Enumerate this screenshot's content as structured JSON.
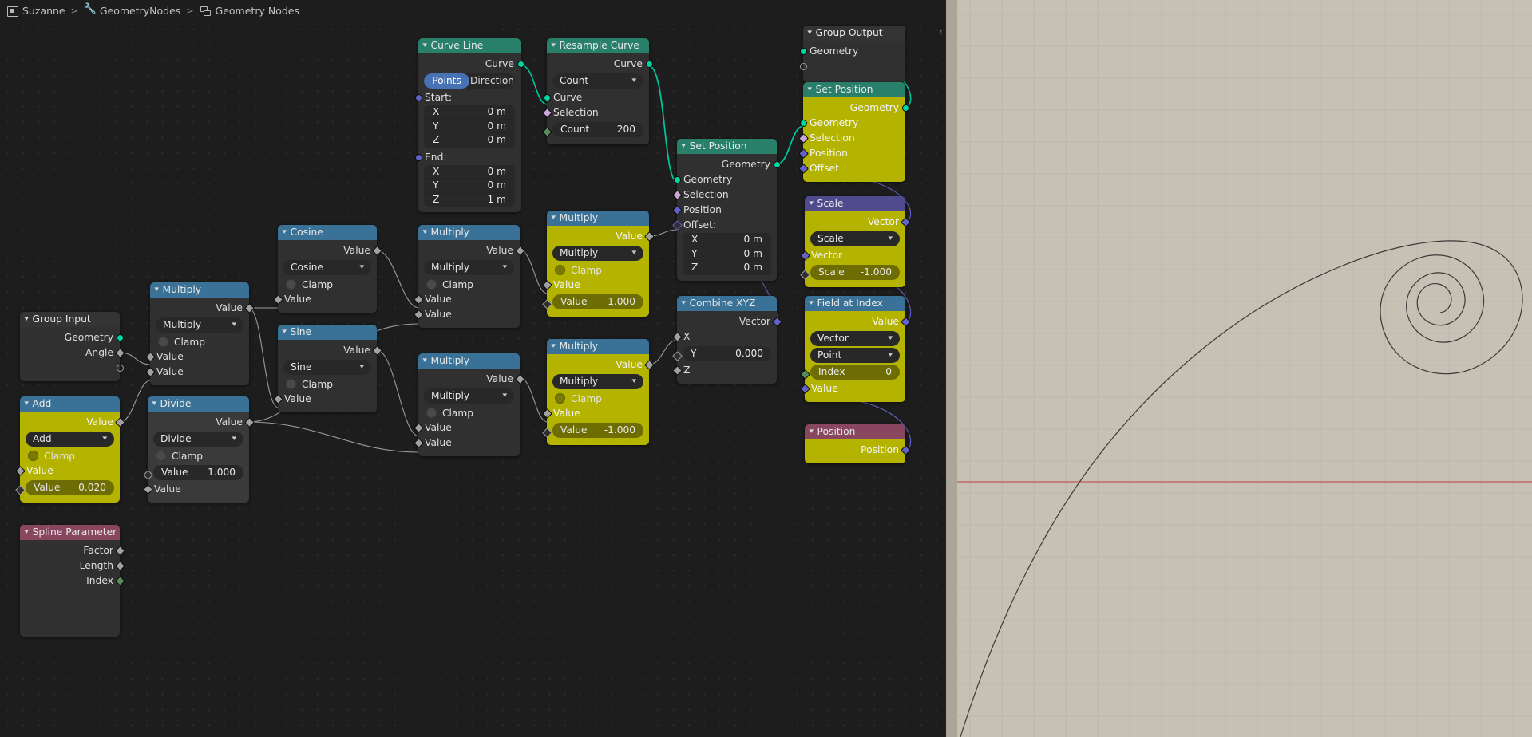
{
  "breadcrumb": {
    "items": [
      {
        "icon": "object-icon",
        "label": "Suzanne"
      },
      {
        "icon": "wrench-icon",
        "label": "GeometryNodes"
      },
      {
        "icon": "nodes-icon",
        "label": "Geometry Nodes"
      }
    ],
    "separator": ">"
  },
  "editor": {
    "collapse_arrow": "‹"
  },
  "colors": {
    "header_teal": "#28806b",
    "header_blue": "#3a7196",
    "header_purple": "#4f4b8e",
    "header_maroon": "#88465f",
    "header_grey": "#343434",
    "body_yellow": "#b3b300",
    "body_dark": "#303030",
    "socket_geometry": "#00d6a3",
    "socket_vector": "#6363c7",
    "socket_value": "#a1a1a1",
    "socket_integer": "#598c5c",
    "socket_boolean": "#cca6d6",
    "toggle_active": "#4772b3",
    "wire_geometry": "#00c49a",
    "wire_value": "#9a9a9a",
    "wire_vector": "#6363c7"
  },
  "nodes": {
    "group_input": {
      "title": "Group Input",
      "outputs": [
        "Geometry",
        "Angle"
      ]
    },
    "add": {
      "title": "Add",
      "output_label": "Value",
      "operation": "Add",
      "clamp_label": "Clamp",
      "input_label": "Value",
      "value_field": {
        "key": "Value",
        "value": "0.020"
      }
    },
    "spline_parameter": {
      "title": "Spline Parameter",
      "outputs": [
        "Factor",
        "Length",
        "Index"
      ]
    },
    "multiply_left": {
      "title": "Multiply",
      "output_label": "Value",
      "operation": "Multiply",
      "clamp_label": "Clamp",
      "inputs": [
        "Value",
        "Value"
      ]
    },
    "divide": {
      "title": "Divide",
      "output_label": "Value",
      "operation": "Divide",
      "clamp_label": "Clamp",
      "value_field": {
        "key": "Value",
        "value": "1.000"
      },
      "input_label": "Value"
    },
    "cosine": {
      "title": "Cosine",
      "output_label": "Value",
      "operation": "Cosine",
      "clamp_label": "Clamp",
      "input_label": "Value"
    },
    "sine": {
      "title": "Sine",
      "output_label": "Value",
      "operation": "Sine",
      "clamp_label": "Clamp",
      "input_label": "Value"
    },
    "multiply_mid_top": {
      "title": "Multiply",
      "output_label": "Value",
      "operation": "Multiply",
      "clamp_label": "Clamp",
      "inputs": [
        "Value",
        "Value"
      ]
    },
    "multiply_mid_bottom": {
      "title": "Multiply",
      "output_label": "Value",
      "operation": "Multiply",
      "clamp_label": "Clamp",
      "inputs": [
        "Value",
        "Value"
      ]
    },
    "curve_line": {
      "title": "Curve Line",
      "output_label": "Curve",
      "toggle": {
        "options": [
          "Points",
          "Direction"
        ],
        "selected": "Points"
      },
      "start_label": "Start:",
      "start": {
        "x": "0 m",
        "y": "0 m",
        "z": "0 m"
      },
      "end_label": "End:",
      "end": {
        "x": "0 m",
        "y": "0 m",
        "z": "1 m"
      },
      "axis_labels": [
        "X",
        "Y",
        "Z"
      ]
    },
    "resample_curve": {
      "title": "Resample Curve",
      "output_label": "Curve",
      "mode": "Count",
      "inputs": [
        "Curve",
        "Selection"
      ],
      "count_field": {
        "key": "Count",
        "value": "200"
      }
    },
    "multiply_yellow_top": {
      "title": "Multiply",
      "output_label": "Value",
      "operation": "Multiply",
      "clamp_label": "Clamp",
      "input_label": "Value",
      "value_field": {
        "key": "Value",
        "value": "-1.000"
      }
    },
    "multiply_yellow_bottom": {
      "title": "Multiply",
      "output_label": "Value",
      "operation": "Multiply",
      "clamp_label": "Clamp",
      "input_label": "Value",
      "value_field": {
        "key": "Value",
        "value": "-1.000"
      }
    },
    "set_position_mid": {
      "title": "Set Position",
      "output_label": "Geometry",
      "inputs": [
        "Geometry",
        "Selection",
        "Position"
      ],
      "offset_label": "Offset:",
      "offset": {
        "x": "0 m",
        "y": "0 m",
        "z": "0 m"
      },
      "axis_labels": [
        "X",
        "Y",
        "Z"
      ]
    },
    "combine_xyz": {
      "title": "Combine XYZ",
      "output_label": "Vector",
      "x_label": "X",
      "y_field": {
        "key": "Y",
        "value": "0.000"
      },
      "z_label": "Z"
    },
    "group_output": {
      "title": "Group Output",
      "input_label": "Geometry"
    },
    "set_position_right": {
      "title": "Set Position",
      "output_label": "Geometry",
      "inputs": [
        "Geometry",
        "Selection",
        "Position",
        "Offset"
      ]
    },
    "scale": {
      "title": "Scale",
      "output_label": "Vector",
      "operation": "Scale",
      "input_label": "Vector",
      "scale_field": {
        "key": "Scale",
        "value": "-1.000"
      }
    },
    "field_at_index": {
      "title": "Field at Index",
      "output_label": "Value",
      "data_type": "Vector",
      "domain": "Point",
      "index_field": {
        "key": "Index",
        "value": "0"
      },
      "input_label": "Value"
    },
    "position": {
      "title": "Position",
      "output_label": "Position"
    }
  }
}
